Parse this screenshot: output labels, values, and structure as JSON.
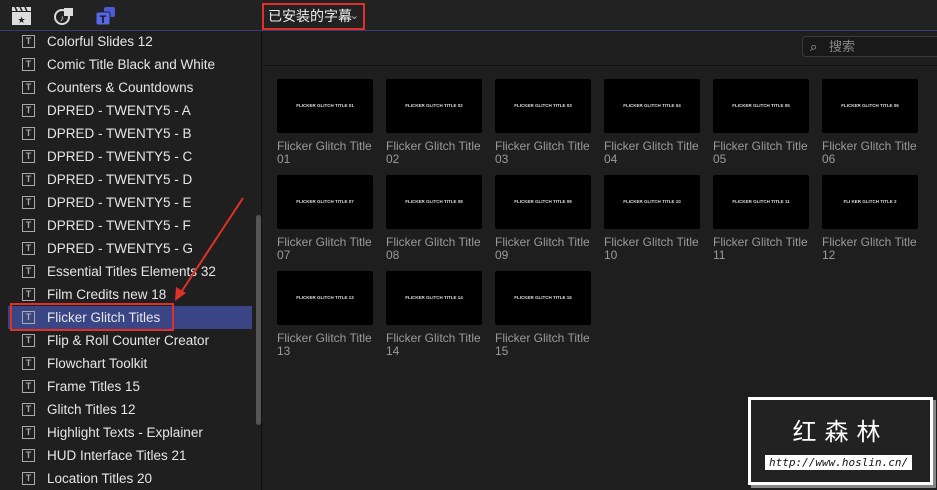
{
  "toolbar": {
    "icons": [
      "clapper-star-icon",
      "music-photo-icon",
      "titles-icon"
    ],
    "dropdown_label": "已安装的字幕",
    "active_color": "#4a5ad8"
  },
  "search": {
    "placeholder": "搜索"
  },
  "sidebar": {
    "selected_index": 12,
    "items": [
      "Colorful Slides 12",
      "Comic Title Black and White",
      "Counters & Countdowns",
      "DPRED - TWENTY5 - A",
      "DPRED - TWENTY5 - B",
      "DPRED - TWENTY5 - C",
      "DPRED - TWENTY5 - D",
      "DPRED - TWENTY5 - E",
      "DPRED - TWENTY5 - F",
      "DPRED - TWENTY5 - G",
      "Essential Titles Elements 32",
      "Film Credits new 18",
      "Flicker Glitch Titles",
      "Flip & Roll Counter Creator",
      "Flowchart Toolkit",
      "Frame Titles 15",
      "Glitch Titles 12",
      "Highlight Texts - Explainer",
      "HUD Interface Titles 21",
      "Location Titles 20"
    ]
  },
  "grid": {
    "items": [
      {
        "thumb": "FLICKER GLITCH TITLE 01",
        "label": "Flicker Glitch Title 01"
      },
      {
        "thumb": "FLICKER GLITCH TITLE 02",
        "label": "Flicker Glitch Title 02"
      },
      {
        "thumb": "FLICKER GLITCH TITLE 03",
        "label": "Flicker Glitch Title 03"
      },
      {
        "thumb": "FLICKER GLITCH TITLE 04",
        "label": "Flicker Glitch Title 04"
      },
      {
        "thumb": "FLICKER GLITCH TITLE 05",
        "label": "Flicker Glitch Title 05"
      },
      {
        "thumb": "FLICKER GLITCH TITLE 06",
        "label": "Flicker Glitch Title 06"
      },
      {
        "thumb": "FLICKER GLITCH TITLE 07",
        "label": "Flicker Glitch Title 07"
      },
      {
        "thumb": "FLICKER GLITCH TITLE 08",
        "label": "Flicker Glitch Title 08"
      },
      {
        "thumb": "FLICKER GLITCH TITLE 09",
        "label": "Flicker Glitch Title 09"
      },
      {
        "thumb": "FLICKER GLITCH TITLE 10",
        "label": "Flicker Glitch Title 10"
      },
      {
        "thumb": "FLICKER GLITCH TITLE 11",
        "label": "Flicker Glitch Title 11"
      },
      {
        "thumb": "FLI KER GLITCH TITLE  2",
        "label": "Flicker Glitch Title 12"
      },
      {
        "thumb": "FLICKER GLITCH TITLE 13",
        "label": "Flicker Glitch Title 13"
      },
      {
        "thumb": "FLICKER GLITCH TITLE 14",
        "label": "Flicker Glitch Title 14"
      },
      {
        "thumb": "FLICKER GLITCH TITLE 15",
        "label": "Flicker Glitch Title 15"
      }
    ]
  },
  "watermark": {
    "name": "红森林",
    "url": "http://www.hoslin.cn/"
  }
}
